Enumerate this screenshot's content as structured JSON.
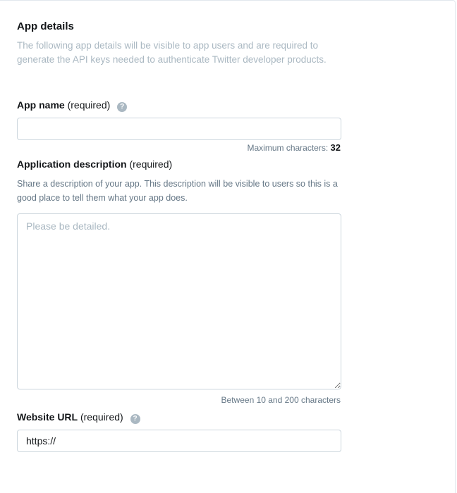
{
  "section": {
    "title": "App details",
    "intro": "The following app details will be visible to app users and are required to generate the API keys needed to authenticate Twitter developer products."
  },
  "app_name": {
    "label": "App name",
    "required": "(required)",
    "help": "?",
    "value": "",
    "hint_prefix": "Maximum characters:",
    "max_chars": "32"
  },
  "description": {
    "label": "Application description",
    "required": "(required)",
    "help_text": "Share a description of your app. This description will be visible to users so this is a good place to tell them what your app does.",
    "placeholder": "Please be detailed.",
    "hint": "Between 10 and 200 characters"
  },
  "website": {
    "label": "Website URL",
    "required": "(required)",
    "help": "?",
    "value": "https://"
  }
}
